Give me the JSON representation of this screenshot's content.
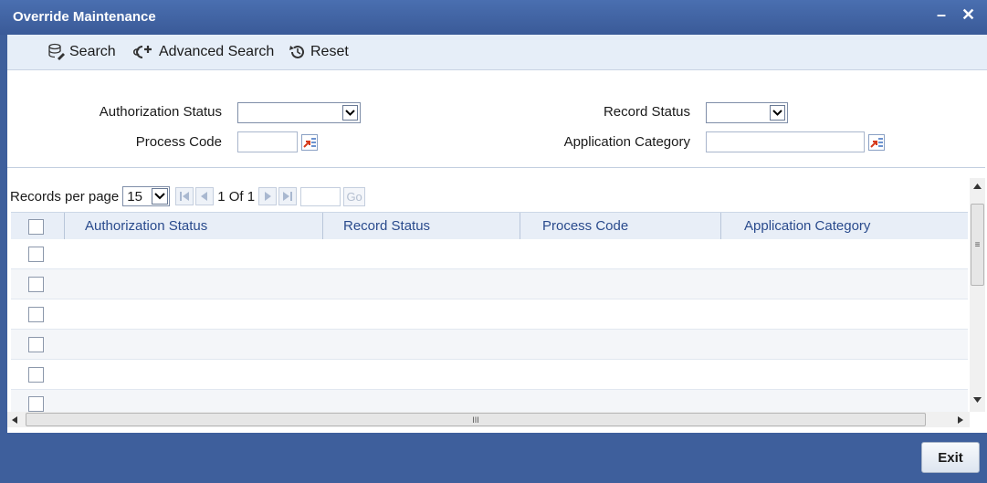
{
  "window": {
    "title": "Override Maintenance",
    "minimize_label": "–",
    "close_label": "✕"
  },
  "toolbar": {
    "search_label": "Search",
    "advanced_search_label": "Advanced Search",
    "reset_label": "Reset"
  },
  "form": {
    "authorization_status_label": "Authorization Status",
    "authorization_status_value": "",
    "process_code_label": "Process Code",
    "process_code_value": "",
    "record_status_label": "Record Status",
    "record_status_value": "",
    "application_category_label": "Application Category",
    "application_category_value": ""
  },
  "pager": {
    "records_per_page_label": "Records per page",
    "records_per_page_value": "15",
    "page_info": "1 Of 1",
    "go_label": "Go",
    "page_input_value": ""
  },
  "grid": {
    "columns": [
      "Authorization Status",
      "Record Status",
      "Process Code",
      "Application Category"
    ],
    "rows": [
      "",
      "",
      "",
      "",
      "",
      ""
    ]
  },
  "hscroll": {
    "grip_label": "III"
  },
  "vscroll": {
    "grip_label": "≡"
  },
  "footer": {
    "exit_label": "Exit"
  },
  "colors": {
    "titlebar": "#3a5a98",
    "header_text": "#2a4b8d",
    "footer": "#3e5f9c"
  }
}
